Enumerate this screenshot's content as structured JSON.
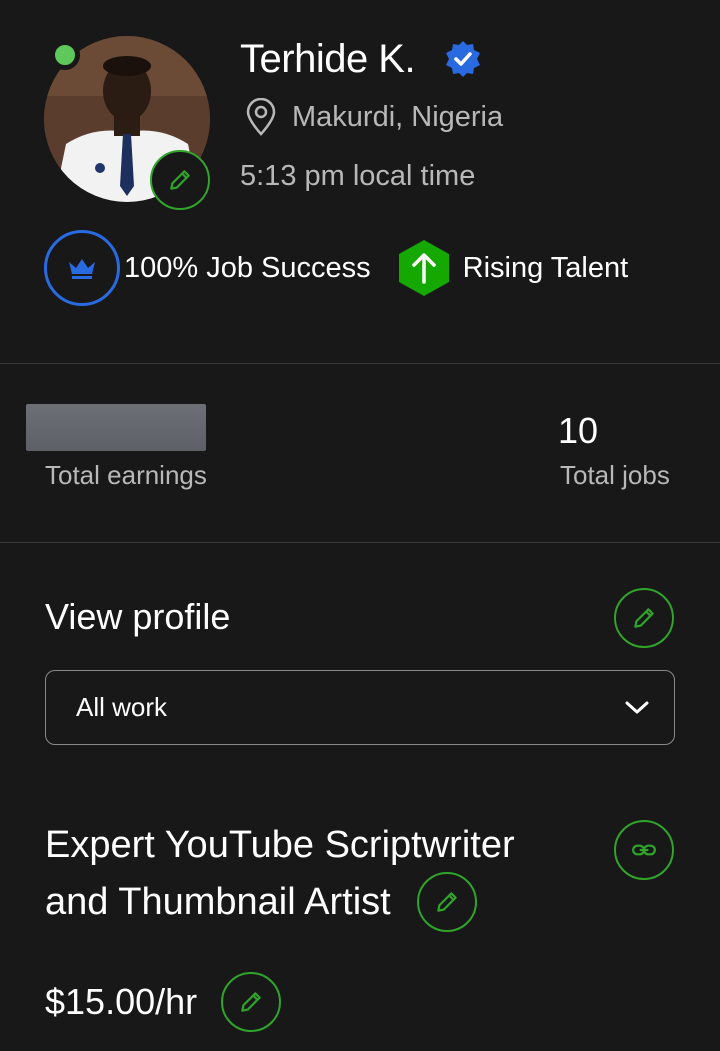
{
  "profile": {
    "name": "Terhide K.",
    "location": "Makurdi, Nigeria",
    "local_time": "5:13 pm local time"
  },
  "badges": {
    "job_success": "100% Job Success",
    "rising_talent": "Rising Talent"
  },
  "stats": {
    "earnings_label": "Total earnings",
    "jobs_value": "10",
    "jobs_label": "Total jobs"
  },
  "view_profile": {
    "label": "View profile",
    "select_value": "All work"
  },
  "title": {
    "line1": "Expert YouTube Scriptwriter",
    "line2": "and Thumbnail Artist"
  },
  "rate": "$15.00/hr",
  "colors": {
    "background": "#181818",
    "accent_green": "#2fa52a",
    "online_green": "#5ec95a",
    "badge_blue": "#2a6ae0",
    "rising_green": "#14a800",
    "muted_text": "#b8b8b8"
  },
  "icons": [
    "online-status-icon",
    "pencil-icon",
    "verified-badge-icon",
    "location-pin-icon",
    "crown-icon",
    "rising-talent-icon",
    "chevron-down-icon",
    "link-icon"
  ]
}
